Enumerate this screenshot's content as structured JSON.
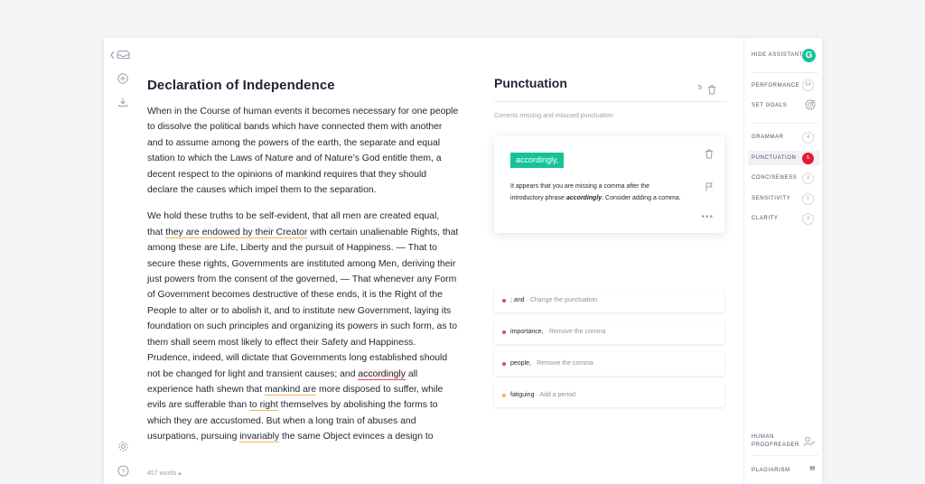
{
  "editor": {
    "title": "Declaration of Independence",
    "paragraph1": [
      "When in the Course of human events it becomes necessary for one people",
      "to dissolve the political bands which have connected them with another",
      "and to assume among the powers of the earth, the separate and equal",
      "station to which the Laws of Nature and of Nature’s God entitle them, a",
      "decent respect to the opinions of mankind requires that they should",
      "declare the causes which impel them to the separation."
    ],
    "p2": {
      "l1": "We hold these truths to be self-evident, that all men are created equal,",
      "l2a": "that ",
      "l2b": "they are endowed by their Creator",
      "l2c": " with certain unalienable Rights, that",
      "l3": "among these are Life, Liberty and the pursuit of Happiness. — That to",
      "l4": "secure these rights, Governments are instituted among Men, deriving their",
      "l5": "just powers from the consent of the governed, — That whenever any Form",
      "l6": "of Government becomes destructive of these ends, it is the Right of the",
      "l7": "People to alter or to abolish it, and to institute new Government, laying its",
      "l8": "foundation on such principles and organizing its powers in such form, as to",
      "l9": "them shall seem most likely to effect their Safety and Happiness.",
      "l10": "Prudence, indeed, will dictate that Governments long established should",
      "l11a": "not be changed for light and transient causes; and ",
      "l11b": "accordingly",
      "l11c": " all",
      "l12a": "experience hath shewn that ",
      "l12b": "mankind are",
      "l12c": " more disposed to suffer, while",
      "l13a": "evils are sufferable than ",
      "l13b": "to right",
      "l13c": " themselves by abolishing the forms to",
      "l14": "which they are accustomed. But when a long train of abuses and",
      "l15a": "usurpations, pursuing ",
      "l15b": "invariably",
      "l15c": " the same Object evinces a design to"
    },
    "word_count": "457 words"
  },
  "assistant": {
    "title": "Punctuation",
    "count": "5",
    "subtitle": "Corrects missing and misused punctuation",
    "card": {
      "chip": "accordingly,",
      "text_a": "It appears that you are missing a comma after the introductory phrase ",
      "text_b": "accordingly",
      "text_c": ". Consider adding a comma."
    },
    "suggestions": [
      {
        "word": "; and",
        "action": "Change the punctuation",
        "color": "#e34850"
      },
      {
        "word": "importance,",
        "action": "Remove the comma",
        "color": "#e34850"
      },
      {
        "word": "people,",
        "action": "Remove the comma",
        "color": "#e34850"
      },
      {
        "word": "fatiguing",
        "action": "Add a period",
        "color": "#f1b84a"
      }
    ]
  },
  "sidebar": {
    "hide_assistant": "HIDE ASSISTANT",
    "performance": "PERFORMANCE",
    "performance_score": "64",
    "set_goals": "SET GOALS",
    "categories": [
      {
        "label": "GRAMMAR",
        "count": "4"
      },
      {
        "label": "PUNCTUATION",
        "count": "5"
      },
      {
        "label": "CONCISENESS",
        "count": "3"
      },
      {
        "label": "SENSITIVITY",
        "count": "1"
      },
      {
        "label": "CLARITY",
        "count": "3"
      }
    ],
    "human_proofreader_1": "HUMAN",
    "human_proofreader_2": "PROOFREADER",
    "plagiarism": "PLAGIARISM"
  },
  "colors": {
    "accent": "#15c39a",
    "alert": "#e3193b",
    "warning": "#f1b84a"
  }
}
